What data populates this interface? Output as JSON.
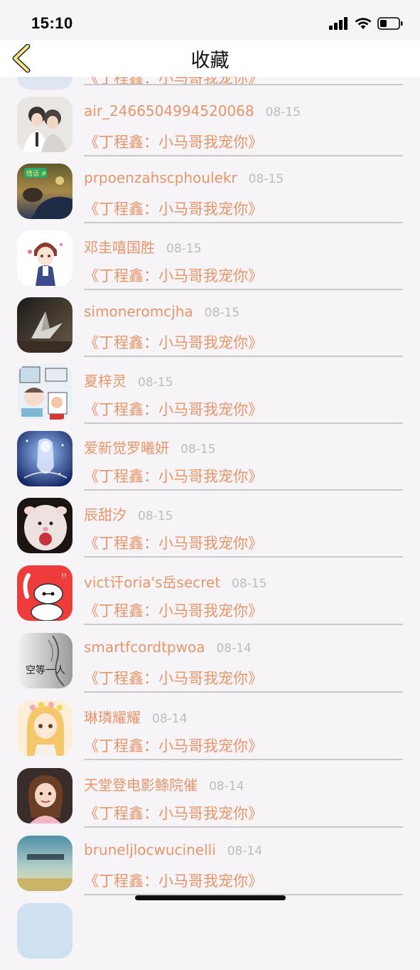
{
  "status_bar": {
    "time": "15:10"
  },
  "nav": {
    "title": "收藏",
    "accent": "#c9a21a"
  },
  "colors": {
    "name": "#e8956a",
    "date": "#bcbcbc",
    "divider": "#c9c9c9",
    "background": "#f6f4f7"
  },
  "partial_top_row": {
    "title": "《丁程鑫：小马哥我宠你》"
  },
  "rows": [
    {
      "name": "air_2466504994520068",
      "date": "08-15",
      "title": "《丁程鑫：小马哥我宠你》",
      "avatar": "avatar-photo-two-boys"
    },
    {
      "name": "prpoenzahscphoulekr",
      "date": "08-15",
      "title": "《丁程鑫：小马哥我宠你》",
      "avatar": "avatar-photo-dusk",
      "avatar_tag": "情话 #"
    },
    {
      "name": "邓圭嘻国胜",
      "date": "08-15",
      "title": "《丁程鑫：小马哥我宠你》",
      "avatar": "avatar-anime-boy"
    },
    {
      "name": "simoneromcjha",
      "date": "08-15",
      "title": "《丁程鑫：小马哥我宠你》",
      "avatar": "avatar-paper-crane"
    },
    {
      "name": "夏梓灵",
      "date": "08-15",
      "title": "《丁程鑫：小马哥我宠你》",
      "avatar": "avatar-cartoon-collage"
    },
    {
      "name": "爱新觉罗曦妍",
      "date": "08-15",
      "title": "《丁程鑫：小马哥我宠你》",
      "avatar": "avatar-blue-fantasy"
    },
    {
      "name": "辰甜汐",
      "date": "08-15",
      "title": "《丁程鑫：小马哥我宠你》",
      "avatar": "avatar-plush-toy"
    },
    {
      "name": "vict讦oria's岳secret",
      "date": "08-15",
      "title": "《丁程鑫：小马哥我宠你》",
      "avatar": "avatar-baymax"
    },
    {
      "name": "smartfcordtpwoa",
      "date": "08-14",
      "title": "《丁程鑫：小马哥我宠你》",
      "avatar": "avatar-sketch-text",
      "avatar_tag": "空等一人"
    },
    {
      "name": "琳璘耀耀",
      "date": "08-14",
      "title": "《丁程鑫：小马哥我宠你》",
      "avatar": "avatar-anime-girl"
    },
    {
      "name": "天堂登电影鲦院催",
      "date": "08-14",
      "title": "《丁程鑫：小马哥我宠你》",
      "avatar": "avatar-girl-photo"
    },
    {
      "name": "bruneljlocwucinelli",
      "date": "08-14",
      "title": "《丁程鑫：小马哥我宠你》",
      "avatar": "avatar-sky-landscape"
    }
  ]
}
